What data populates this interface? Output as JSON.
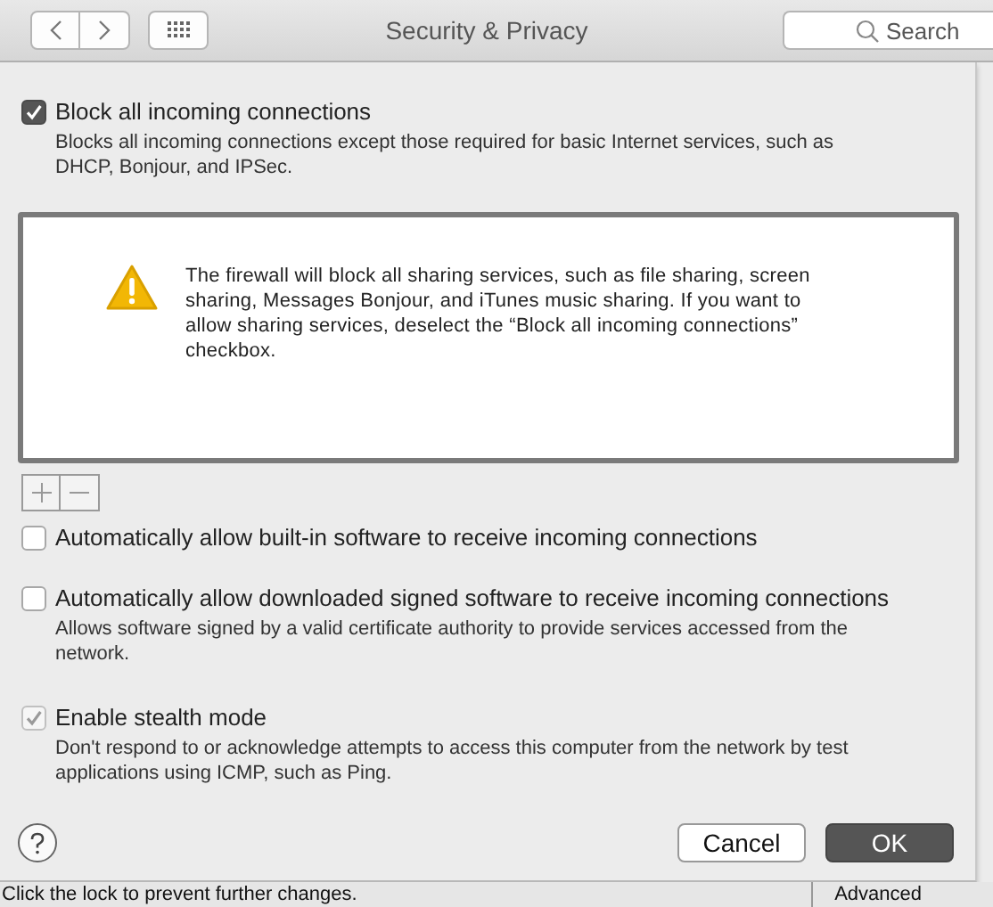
{
  "window": {
    "title": "Security & Privacy"
  },
  "search": {
    "placeholder": "Search"
  },
  "block_all": {
    "label": "Block all incoming connections",
    "checked": true,
    "disabled": false,
    "description": "Blocks all incoming connections except those required for basic Internet services, such as DHCP, Bonjour, and IPSec."
  },
  "app_list": {
    "message": "The firewall will block all sharing services, such as file sharing, screen sharing, Messages Bonjour, and iTunes music sharing. If you want to allow sharing services, deselect the “Block all incoming connections” checkbox."
  },
  "options": [
    {
      "label": "Automatically allow built-in software to receive incoming connections",
      "checked": false,
      "disabled": false
    },
    {
      "label": "Automatically allow downloaded signed software to receive incoming connections",
      "checked": false,
      "disabled": false,
      "description": "Allows software signed by a valid certificate authority to provide services accessed from the network."
    },
    {
      "label": "Enable stealth mode",
      "checked": true,
      "disabled": true,
      "description": "Don't respond to or acknowledge attempts to access this computer from the network by test applications using ICMP, such as Ping."
    }
  ],
  "buttons": [
    {
      "label": "Cancel",
      "default": false
    },
    {
      "label": "OK",
      "default": true
    }
  ],
  "background_window": {
    "lock_text": "Click the lock to prevent further changes.",
    "button": "Advanced"
  }
}
